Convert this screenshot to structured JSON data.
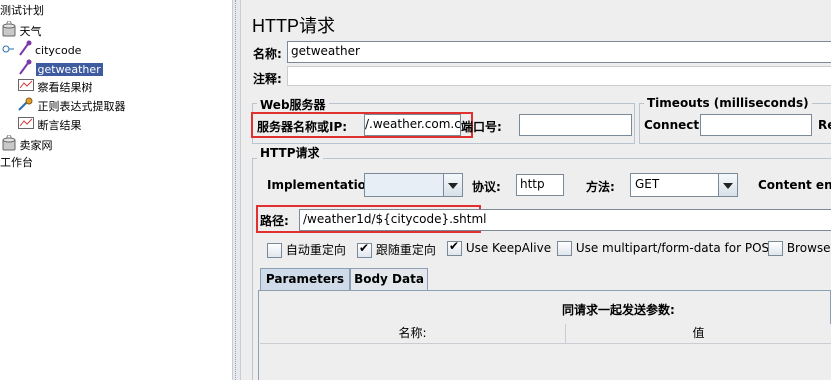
{
  "tree": {
    "items": [
      {
        "label": "测试计划",
        "icon": "test-plan-icon"
      },
      {
        "label": "天气",
        "icon": "thread-group-icon"
      },
      {
        "label": "citycode",
        "icon": "pipette-icon"
      },
      {
        "label": "getweather",
        "icon": "pipette-icon"
      },
      {
        "label": "察看结果树",
        "icon": "result-tree-icon"
      },
      {
        "label": "正则表达式提取器",
        "icon": "regex-extractor-icon"
      },
      {
        "label": "断言结果",
        "icon": "assertion-result-icon"
      },
      {
        "label": "卖家网",
        "icon": "thread-group-icon"
      },
      {
        "label": "工作台",
        "icon": "workbench-icon"
      }
    ]
  },
  "panel": {
    "title": "HTTP请求",
    "name_label": "名称:",
    "name_value": "getweather",
    "comment_label": "注释:",
    "comment_value": ""
  },
  "web_server": {
    "group_title": "Web服务器",
    "server_label": "服务器名称或IP:",
    "server_value": "/.weather.com.cn",
    "port_label": "端口号:",
    "port_value": ""
  },
  "timeouts": {
    "group_title": "Timeouts (milliseconds)",
    "connect_label": "Connect:",
    "connect_value": "",
    "response_label": "Re"
  },
  "http_request": {
    "group_title": "HTTP请求",
    "impl_label": "Implementation:",
    "impl_value": "",
    "protocol_label": "协议:",
    "protocol_value": "http",
    "method_label": "方法:",
    "method_value": "GET",
    "content_encoding_label": "Content enco",
    "path_label": "路径:",
    "path_value": "/weather1d/${citycode}.shtml"
  },
  "options": [
    {
      "label": "自动重定向",
      "checked": false
    },
    {
      "label": "跟随重定向",
      "checked": true
    },
    {
      "label": "Use KeepAlive",
      "checked": true
    },
    {
      "label": "Use multipart/form-data for POST",
      "checked": false
    },
    {
      "label": "Browser",
      "checked": false
    }
  ],
  "tabs": {
    "parameters": "Parameters",
    "body_data": "Body Data"
  },
  "params_table": {
    "heading": "同请求一起发送参数:",
    "col_name": "名称:",
    "col_value": "值"
  },
  "colors": {
    "selection": "#3d5b9e",
    "highlight_box": "#e03030",
    "panel_bg": "#eeeeee"
  }
}
